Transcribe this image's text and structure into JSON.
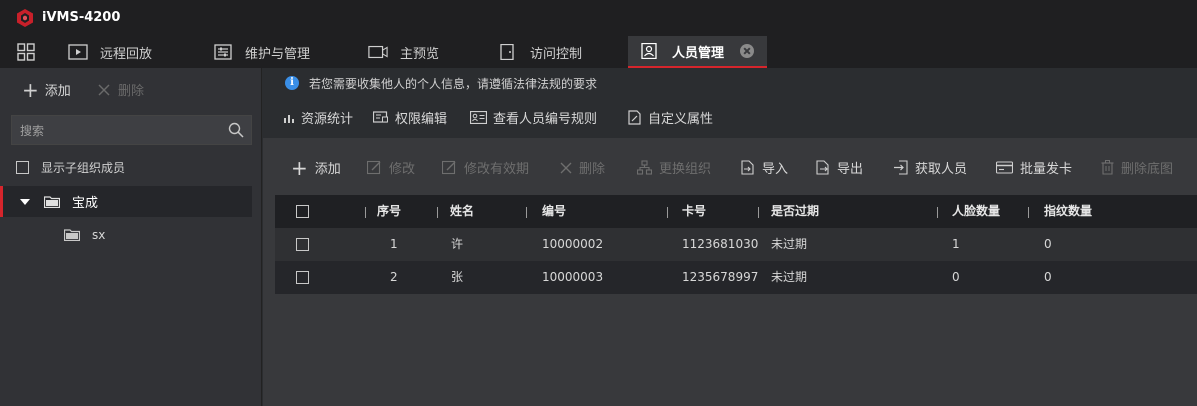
{
  "app": {
    "title": "iVMS-4200"
  },
  "tabs": [
    {
      "label": "远程回放",
      "icon": "playback-icon"
    },
    {
      "label": "维护与管理",
      "icon": "maintenance-icon"
    },
    {
      "label": "主预览",
      "icon": "preview-icon"
    },
    {
      "label": "访问控制",
      "icon": "access-control-icon"
    },
    {
      "label": "人员管理",
      "icon": "person-management-icon",
      "active": true
    }
  ],
  "left": {
    "add_label": "添加",
    "delete_label": "删除",
    "search_placeholder": "搜索",
    "show_sub_label": "显示子组织成员",
    "tree": [
      {
        "label": "宝成",
        "expanded": true,
        "selected": true
      },
      {
        "label": "sx"
      }
    ]
  },
  "main": {
    "notice": "若您需要收集他人的个人信息，请遵循法律法规的要求",
    "toolbar": [
      "资源统计",
      "权限编辑",
      "查看人员编号规则",
      "自定义属性"
    ],
    "actions": {
      "add": "添加",
      "modify": "修改",
      "modify_validity": "修改有效期",
      "delete": "删除",
      "change_org": "更换组织",
      "import": "导入",
      "export": "导出",
      "get_person": "获取人员",
      "batch_issue_card": "批量发卡",
      "delete_photo": "删除底图"
    },
    "table": {
      "headers": [
        "序号",
        "姓名",
        "编号",
        "卡号",
        "是否过期",
        "人脸数量",
        "指纹数量"
      ],
      "rows": [
        [
          "1",
          "许",
          "10000002",
          "1123681030",
          "未过期",
          "1",
          "0"
        ],
        [
          "2",
          "张",
          "10000003",
          "1235678997",
          "未过期",
          "0",
          "0"
        ]
      ]
    }
  },
  "colors": {
    "accent": "#d6252c",
    "info": "#3a8ee6",
    "background": "#2b2d30"
  }
}
